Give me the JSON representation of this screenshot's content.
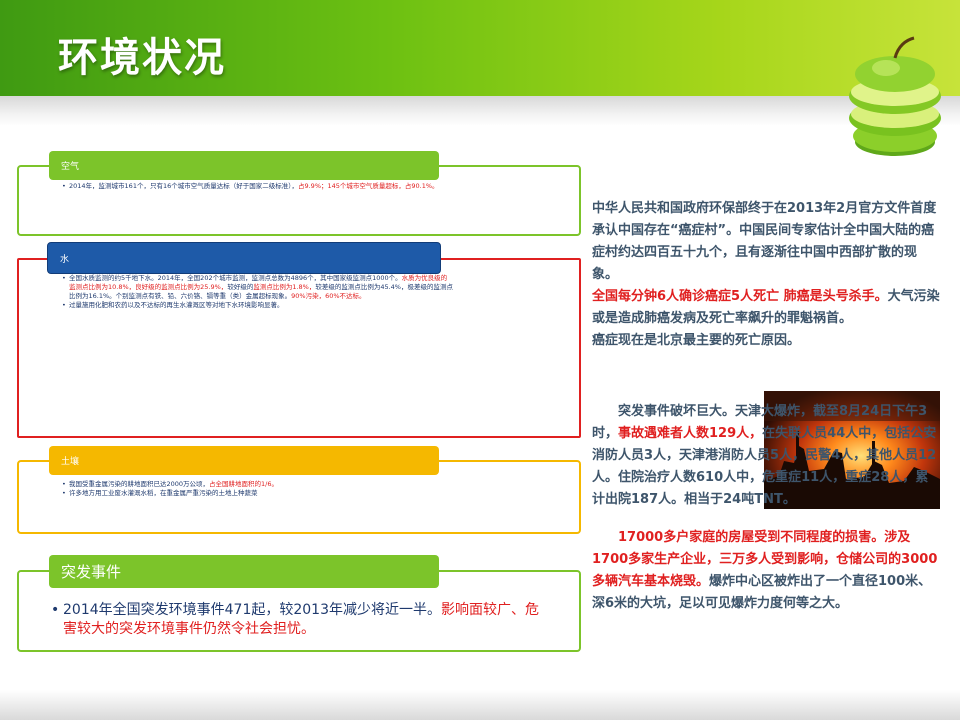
{
  "slide": {
    "title": "环境状况"
  },
  "colors": {
    "green": "#7cc42a",
    "blue": "#1e5aa8",
    "red": "#e02020",
    "yellow": "#f5b800",
    "text": "#3e556b",
    "list_text": "#1f3a6e"
  },
  "sections": {
    "air": {
      "label": "空气",
      "bullet_a": "2014年，监测城市161个，只有16个城市空气质量达标（好于国家二级标准），",
      "bullet_a_red": "占9.9%；145个城市空气质量超标，占90.1%。"
    },
    "water": {
      "label": "水",
      "line1": "全国水质监测的约5千地下水。2014年，全国202个城市监测，监测点总数为4896个，其中国家级监测点1000个。",
      "line1_red": "水质为优良级的",
      "line2_red": "监测点比例为10.8%，良好级的监测点比例为25.9%，",
      "line2": "较好级的",
      "line2_red_b": "监测点比例为1.8%，",
      "line2_b": "较差级的监测点比例为45.4%，极差级的监测点",
      "line3": "比例为16.1%。个别监测点有铁、铅、六价铬、镉等重（类）金属超标现象。",
      "line3_red": "90%污染，60%不达标。",
      "bullet2": "过量施用化肥和农药以及不达标的再生水灌溉区等对地下水环境影响显著。"
    },
    "soil": {
      "label": "土壤",
      "bullet1": "我国受重金属污染的耕地面积已达2000万公顷，",
      "bullet1_red": "占全国耕地面积的1/6。",
      "bullet2": "许多地方用工业废水灌溉水稻，在重金属严重污染的土地上种蔬菜"
    },
    "emergency": {
      "label": "突发事件",
      "text": "2014年全国突发环境事件471起，较2013年减少将近一半。",
      "text_red": "影响面较广、危害较大的突发环境事件仍然令社会担忧。"
    }
  },
  "right": {
    "p1": "中华人民共和国政府环保部终于在2013年2月官方文件首度承认中国存在“癌症村”。中国民间专家估计全中国大陆的癌症村约达四百五十九个，且有逐渐往中国中西部扩散的现象。",
    "p2_red": "全国每分钟6人确诊癌症5人死亡 肺癌是头号杀手。",
    "p2": "大气污染或是造成肺癌发病及死亡率飙升的罪魁祸首。",
    "p3": "癌症现在是北京最主要的死亡原因。",
    "p4_a": "突发事件破坏巨大。天津大爆炸，截至8月24日下午3时，",
    "p4_red": "事故遇难者人数129人，",
    "p4_b": "在失联人员44人中，包括公安消防人员3人，天津港消防人员5人，民警4人，其他人员12人。住院治疗人数610人中，危重症11人，重症28人，累计出院187人。相当于24吨TNT。",
    "p5_red": "17000多户家庭的房屋受到不同程度的损害。涉及1700多家生产企业，三万多人受到影响，仓储公司的3000多辆汽车基本烧毁。",
    "p5": "爆炸中心区被炸出了一个直径100米、深6米的大坑，足以可见爆炸力度何等之大。"
  },
  "icons": {
    "apple": "apple-stack-icon",
    "photo": "explosion-photo"
  }
}
